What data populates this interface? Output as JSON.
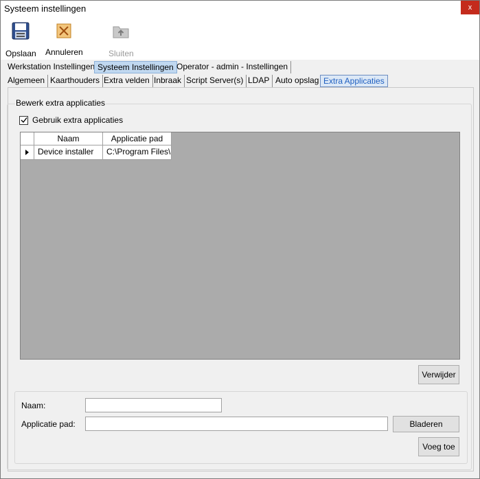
{
  "window": {
    "title": "Systeem instellingen",
    "close_label": "x"
  },
  "toolbar": {
    "save_label": "Opslaan",
    "cancel_label": "Annuleren",
    "close_label": "Sluiten"
  },
  "tabs_main": [
    "Werkstation Instellingen",
    "Systeem Instellingen",
    "Operator - admin - Instellingen"
  ],
  "tabs_sub": [
    "Algemeen",
    "Kaarthouders",
    "Extra velden",
    "Inbraak",
    "Script Server(s)",
    "LDAP",
    "Auto opslag",
    "Extra Applicaties"
  ],
  "group": {
    "title": "Bewerk extra applicaties",
    "checkbox_label": "Gebruik extra applicaties",
    "checkbox_checked": true
  },
  "grid": {
    "columns": [
      "Naam",
      "Applicatie pad"
    ],
    "rows": [
      [
        "Device installer",
        "C:\\Program Files\\"
      ]
    ]
  },
  "buttons": {
    "remove": "Verwijder",
    "browse": "Bladeren",
    "add": "Voeg toe"
  },
  "form": {
    "name_label": "Naam:",
    "name_value": "",
    "path_label": "Applicatie pad:",
    "path_value": ""
  }
}
